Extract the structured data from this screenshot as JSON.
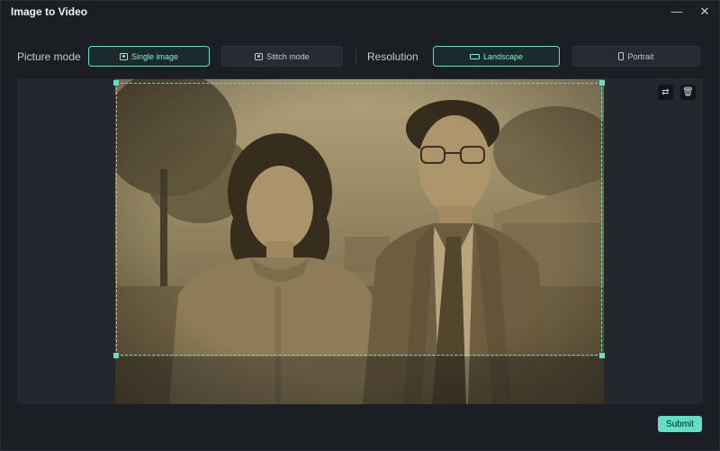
{
  "window": {
    "title": "Image to Video"
  },
  "window_controls": {
    "minimize": "—",
    "close": "✕"
  },
  "picture_mode": {
    "label": "Picture mode",
    "options": [
      {
        "label": "Single image",
        "icon": "image-icon",
        "selected": true
      },
      {
        "label": "Stitch mode",
        "icon": "stitch-icon",
        "selected": false
      }
    ]
  },
  "resolution": {
    "label": "Resolution",
    "options": [
      {
        "label": "Landscape",
        "icon": "landscape-icon",
        "selected": true
      },
      {
        "label": "Portrait",
        "icon": "portrait-icon",
        "selected": false
      }
    ]
  },
  "image_tools": {
    "replace": "replace-icon",
    "delete": "trash-icon"
  },
  "footer": {
    "submit_label": "Submit"
  },
  "colors": {
    "accent": "#5fe0c8",
    "background": "#1b1e23",
    "panel": "#24282e"
  }
}
